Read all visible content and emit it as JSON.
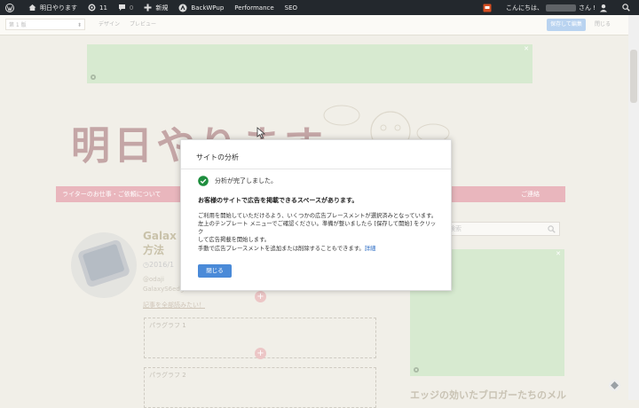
{
  "adminbar": {
    "site_name": "明日やります",
    "updates_count": "11",
    "comments_count": "0",
    "new_label": "新規",
    "backwpup_label": "BackWPup",
    "performance_label": "Performance",
    "seo_label": "SEO",
    "greeting": "こんにちは、",
    "greeting_suffix": "さん !"
  },
  "toolbar": {
    "select_value": "第 1 版",
    "design_label": "デザイン",
    "preview_label": "プレビュー",
    "save_label": "保存して編集",
    "close_label": "閉じる"
  },
  "page": {
    "site_title": "明日やります",
    "nav_items": [
      "ライターのお仕事・ご依頼について",
      "ご連絡"
    ],
    "post_title_line1": "Galax",
    "post_title_line2": "方法",
    "post_date": "2016/1",
    "excerpt_line1": "@odaji",
    "excerpt_line2": "GalaxyS6edge",
    "read_more": "記事を全部読みたい！",
    "paragraph_1": "パラグラフ 1",
    "paragraph_2": "パラグラフ 2",
    "search_placeholder": "検索",
    "sidebar_title": "エッジの効いたブロガーたちのメル"
  },
  "modal": {
    "title": "サイトの分析",
    "done_text": "分析が完了しました。",
    "heading": "お客様のサイトで広告を掲載できるスペースがあります。",
    "body_line1": "ご利用を開始していただけるよう、いくつかの広告プレースメントが選択済みとなっています。",
    "body_line2": "左上のテンプレート メニューでご確認ください。準備が整いましたら [保存して開始] をクリック",
    "body_line3": "して広告掲載を開始します。",
    "footer_text": "手動で広告プレースメントを追加または削除することもできます。",
    "footer_link": "詳細",
    "close_button": "閉じる"
  },
  "colors": {
    "adminbar_bg": "#23282d",
    "ad_placeholder": "#d7ead0",
    "nav_pink": "#e9b6bd",
    "primary_button": "#4a8ad8",
    "check_green": "#1e8e3e"
  }
}
